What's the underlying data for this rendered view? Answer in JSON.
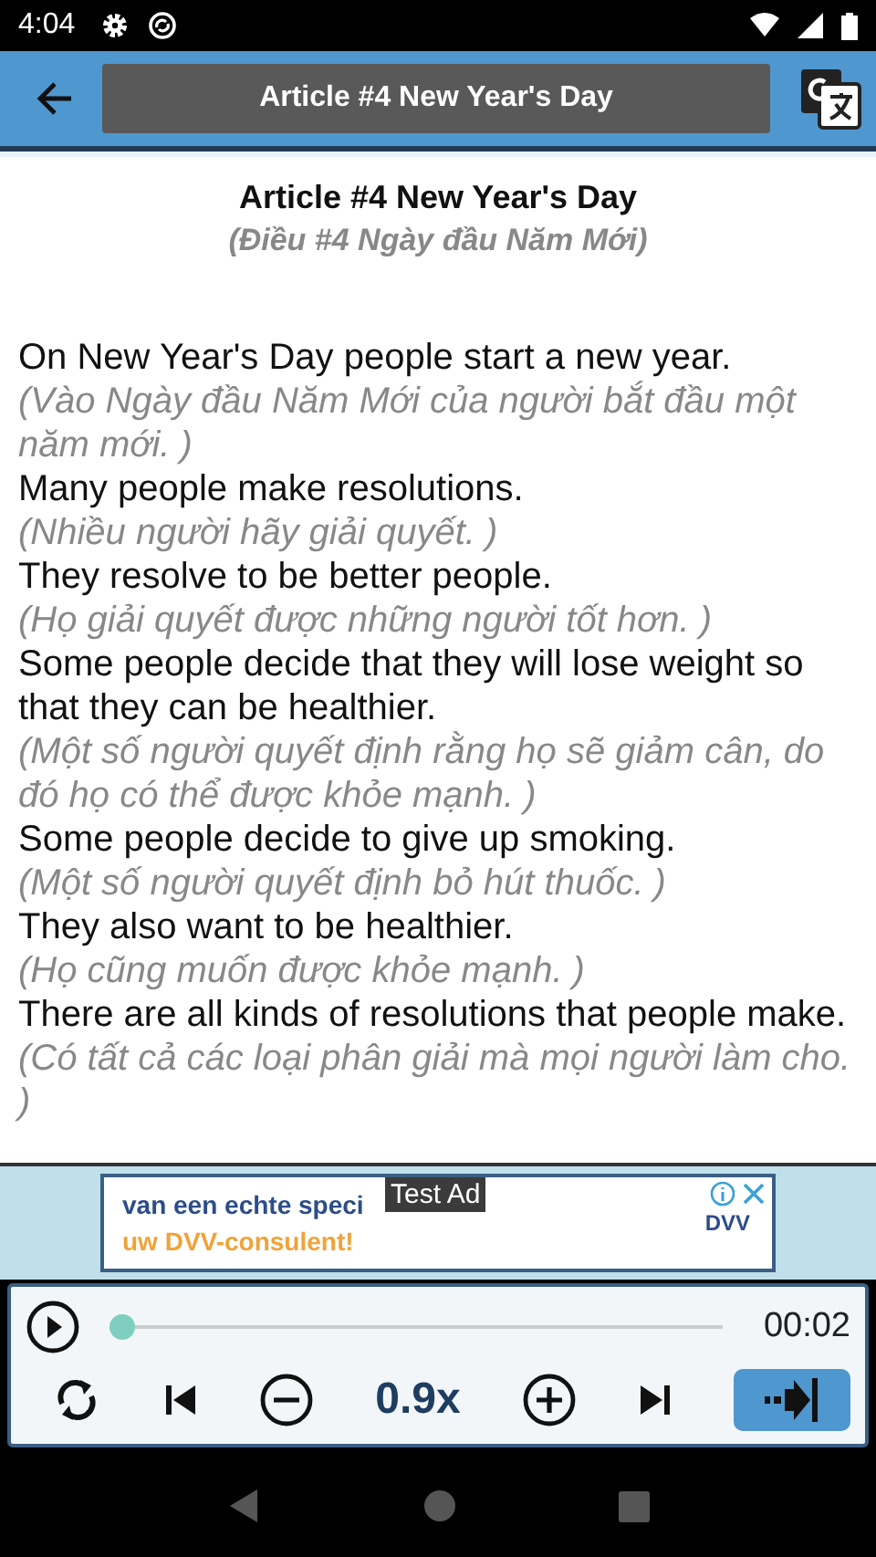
{
  "status_bar": {
    "time": "4:04"
  },
  "toolbar": {
    "title": "Article #4 New Year's Day"
  },
  "article": {
    "title": "Article #4 New Year's Day",
    "subtitle": "(Điều #4 Ngày đầu Năm Mới)",
    "sentences": [
      {
        "text": "On New Year's Day people start a new year.",
        "translation": "(Vào Ngày đầu Năm Mới của người bắt đầu một năm mới. )"
      },
      {
        "text": "Many people make resolutions.",
        "translation": "(Nhiều người hãy giải quyết. )"
      },
      {
        "text": "They resolve to be better people.",
        "translation": "(Họ giải quyết được những người tốt hơn. )"
      },
      {
        "text": "Some people decide that they will lose weight so that they can be healthier.",
        "translation": "(Một số người quyết định rằng họ sẽ giảm cân, do đó họ có thể được khỏe mạnh. )"
      },
      {
        "text": "Some people decide to give up smoking.",
        "translation": "(Một số người quyết định bỏ hút thuốc. )"
      },
      {
        "text": "They also want to be healthier.",
        "translation": "(Họ cũng muốn được khỏe mạnh. )"
      },
      {
        "text": "There are all kinds of resolutions that people make.",
        "translation": "(Có tất cả các loại phân giải mà mọi người làm cho. )"
      }
    ]
  },
  "ad": {
    "line_1": "van een echte speci",
    "line_2": "uw DVV-consulent!",
    "label": "Test Ad",
    "brand": "DVV"
  },
  "player": {
    "level": 0.02,
    "time": "00:02",
    "speed": "0.9x"
  }
}
